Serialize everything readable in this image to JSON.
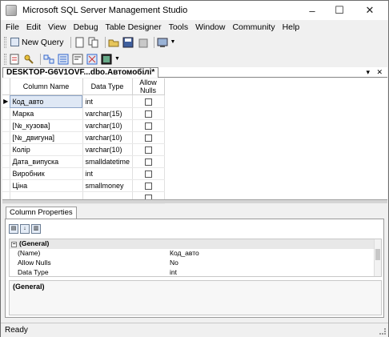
{
  "window": {
    "title": "Microsoft SQL Server Management Studio",
    "controls": {
      "minimize": "–",
      "maximize": "☐",
      "close": "✕"
    }
  },
  "menu": [
    "File",
    "Edit",
    "View",
    "Debug",
    "Table Designer",
    "Tools",
    "Window",
    "Community",
    "Help"
  ],
  "toolbar": {
    "new_query_label": "New Query"
  },
  "document": {
    "tab_label": "DESKTOP-G6V1OVF...dbo.Автомобілі*",
    "pin_glyph": "▾",
    "close_glyph": "✕"
  },
  "designer": {
    "headers": {
      "name": "Column Name",
      "type": "Data Type",
      "nulls": "Allow Nulls"
    },
    "current_row_marker": "▶",
    "rows": [
      {
        "name": "Код_авто",
        "type": "int",
        "allow_nulls": false
      },
      {
        "name": "Марка",
        "type": "varchar(15)",
        "allow_nulls": false
      },
      {
        "name": "[№_кузова]",
        "type": "varchar(10)",
        "allow_nulls": false
      },
      {
        "name": "[№_двигуна]",
        "type": "varchar(10)",
        "allow_nulls": false
      },
      {
        "name": "Колір",
        "type": "varchar(10)",
        "allow_nulls": false
      },
      {
        "name": "Дата_випуска",
        "type": "smalldatetime",
        "allow_nulls": false
      },
      {
        "name": "Виробник",
        "type": "int",
        "allow_nulls": false
      },
      {
        "name": "Ціна",
        "type": "smallmoney",
        "allow_nulls": false
      },
      {
        "name": "",
        "type": "",
        "allow_nulls": false
      }
    ]
  },
  "properties": {
    "tab_label": "Column Properties",
    "category": "(General)",
    "expand_glyph": "−",
    "items": [
      {
        "key": "(Name)",
        "value": "Код_авто"
      },
      {
        "key": "Allow Nulls",
        "value": "No"
      },
      {
        "key": "Data Type",
        "value": "int"
      }
    ],
    "description_title": "(General)"
  },
  "status": {
    "text": "Ready"
  }
}
